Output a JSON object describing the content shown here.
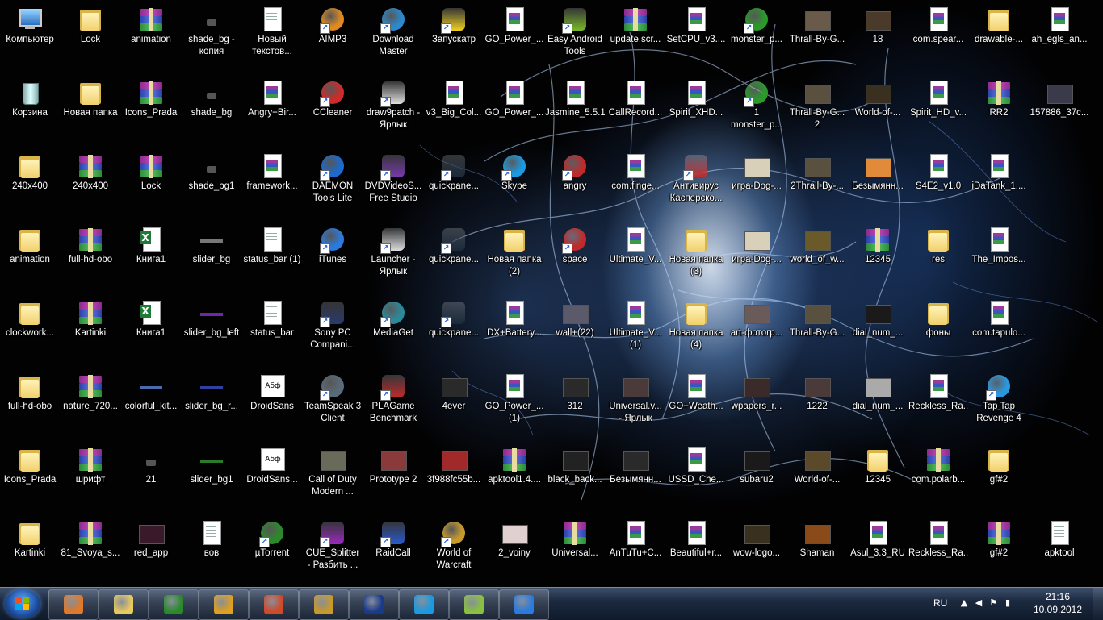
{
  "desktop": {
    "columns": [
      [
        {
          "label": "Компьютер",
          "type": "pc"
        },
        {
          "label": "Корзина",
          "type": "bin"
        },
        {
          "label": "240x400",
          "type": "folder"
        },
        {
          "label": "animation",
          "type": "folder"
        },
        {
          "label": "clockwork...",
          "type": "folder"
        },
        {
          "label": "full-hd-obo",
          "type": "folder"
        },
        {
          "label": "Icons_Prada",
          "type": "folder"
        },
        {
          "label": "Kartinki",
          "type": "folder"
        }
      ],
      [
        {
          "label": "Lock",
          "type": "folder"
        },
        {
          "label": "Новая папка",
          "type": "folder"
        },
        {
          "label": "240x400",
          "type": "rar"
        },
        {
          "label": "full-hd-obo",
          "type": "rar"
        },
        {
          "label": "Kartinki",
          "type": "rar"
        },
        {
          "label": "nature_720...",
          "type": "rar"
        },
        {
          "label": "шрифт",
          "type": "rar"
        },
        {
          "label": "81_Svoya_s...",
          "type": "rar"
        }
      ],
      [
        {
          "label": "animation",
          "type": "rar"
        },
        {
          "label": "Icons_Prada",
          "type": "rar"
        },
        {
          "label": "Lock",
          "type": "rar"
        },
        {
          "label": "Книга1",
          "type": "excel"
        },
        {
          "label": "Книга1",
          "type": "excel"
        },
        {
          "label": "colorful_kit...",
          "type": "strip",
          "color": "#4a6ab0"
        },
        {
          "label": "21",
          "type": "small"
        },
        {
          "label": "red_app",
          "type": "thumb",
          "color": "#3a1a2a"
        }
      ],
      [
        {
          "label": "shade_bg -\nкопия",
          "type": "small"
        },
        {
          "label": "shade_bg",
          "type": "small"
        },
        {
          "label": "shade_bg1",
          "type": "small"
        },
        {
          "label": "slider_bg",
          "type": "strip",
          "color": "#777777"
        },
        {
          "label": "slider_bg_left",
          "type": "strip",
          "color": "#6a2aa8"
        },
        {
          "label": "slider_bg_r...",
          "type": "strip",
          "color": "#3040a0"
        },
        {
          "label": "slider_bg1",
          "type": "strip",
          "color": "#2a7a2a"
        },
        {
          "label": "вов",
          "type": "doc"
        }
      ],
      [
        {
          "label": "Новый\nтекстов...",
          "type": "doc"
        },
        {
          "label": "Angry+Bir...",
          "type": "rarfile"
        },
        {
          "label": "framework...",
          "type": "rarfile"
        },
        {
          "label": "status_bar (1)",
          "type": "doc"
        },
        {
          "label": "status_bar",
          "type": "doc"
        },
        {
          "label": "DroidSans",
          "type": "font",
          "font_sample": "Абф"
        },
        {
          "label": "DroidSans...",
          "type": "font",
          "font_sample": "Абф"
        },
        {
          "label": "µTorrent",
          "type": "round",
          "color": "#2a8a2a"
        }
      ],
      [
        {
          "label": "AIMP3",
          "type": "round",
          "color": "#e08a20"
        },
        {
          "label": "CCleaner",
          "type": "round",
          "color": "#d02a2a"
        },
        {
          "label": "DAEMON\nTools Lite",
          "type": "round",
          "color": "#1a6ad0"
        },
        {
          "label": "iTunes",
          "type": "round",
          "color": "#2a7ae0"
        },
        {
          "label": "Sony PC\nCompani...",
          "type": "app",
          "color": "#2a3a6a"
        },
        {
          "label": "TeamSpeak 3\nClient",
          "type": "round",
          "color": "#5a6a7a"
        },
        {
          "label": "Call of Duty\nModern ...",
          "type": "thumb",
          "color": "#6a6a5a"
        },
        {
          "label": "CUE_Splitter\n- Разбить ...",
          "type": "app",
          "color": "#9a2ac0"
        }
      ],
      [
        {
          "label": "Download\nMaster",
          "type": "round",
          "color": "#2a8ad0"
        },
        {
          "label": "draw9patch -\nЯрлык",
          "type": "app",
          "color": "#e0e0e0"
        },
        {
          "label": "DVDVideoS...\nFree Studio",
          "type": "app",
          "color": "#7a3ab0"
        },
        {
          "label": "Launcher -\nЯрлык",
          "type": "app",
          "color": "#dddddd"
        },
        {
          "label": "MediaGet",
          "type": "round",
          "color": "#2a8a9a"
        },
        {
          "label": "PLAGame\nBenchmark",
          "type": "app",
          "color": "#c02a2a"
        },
        {
          "label": "Prototype 2",
          "type": "thumb",
          "color": "#8a3a3a"
        },
        {
          "label": "RaidCall",
          "type": "app",
          "color": "#2a5ad0"
        }
      ],
      [
        {
          "label": "Запускатр",
          "type": "app",
          "color": "#f0d020"
        },
        {
          "label": "v3_Big_Col...",
          "type": "rarfile"
        },
        {
          "label": "quickpane...",
          "type": "app",
          "color": "#1a2a3a"
        },
        {
          "label": "quickpane...",
          "type": "app",
          "color": "#1a2a3a"
        },
        {
          "label": "quickpane...",
          "type": "app",
          "color": "#1a2a3a"
        },
        {
          "label": "4ever",
          "type": "thumb",
          "color": "#2a2a2a"
        },
        {
          "label": "3f988fc55b...",
          "type": "thumb",
          "color": "#a02a2a"
        },
        {
          "label": "World of\nWarcraft",
          "type": "round",
          "color": "#c89a2a"
        }
      ],
      [
        {
          "label": "GO_Power_...",
          "type": "rarfile"
        },
        {
          "label": "GO_Power_...",
          "type": "rarfile"
        },
        {
          "label": "Skype",
          "type": "round",
          "color": "#1a9ae0"
        },
        {
          "label": "Новая папка\n(2)",
          "type": "folder"
        },
        {
          "label": "DX+Battery...",
          "type": "rarfile"
        },
        {
          "label": "GO_Power_...\n(1)",
          "type": "rarfile"
        },
        {
          "label": "apktool1.4....",
          "type": "rar"
        },
        {
          "label": "2_voiny",
          "type": "thumb",
          "color": "#e0d0d0"
        }
      ],
      [
        {
          "label": "Easy Android\nTools",
          "type": "app",
          "color": "#7ab82a"
        },
        {
          "label": "Jasmine_5.5.1",
          "type": "rarfile"
        },
        {
          "label": "angry",
          "type": "round",
          "color": "#c02a2a"
        },
        {
          "label": "space",
          "type": "round",
          "color": "#c02a2a"
        },
        {
          "label": "wall+(22)",
          "type": "thumb",
          "color": "#5a5a6a"
        },
        {
          "label": "312",
          "type": "thumb",
          "color": "#2a2a2a"
        },
        {
          "label": "black_back...",
          "type": "thumb",
          "color": "#222222"
        },
        {
          "label": "Universal...",
          "type": "rar"
        }
      ],
      [
        {
          "label": "update.scr...",
          "type": "rar"
        },
        {
          "label": "CallRecord...",
          "type": "rarfile"
        },
        {
          "label": "com.finge...",
          "type": "rarfile"
        },
        {
          "label": "Ultimate_V...",
          "type": "rarfile"
        },
        {
          "label": "Ultimate_V...\n(1)",
          "type": "rarfile"
        },
        {
          "label": "Universal.v...\n- Ярлык",
          "type": "thumb",
          "color": "#4a3a3a"
        },
        {
          "label": "Безымянн...",
          "type": "thumb",
          "color": "#2a2a2a"
        },
        {
          "label": "AnTuTu+C...",
          "type": "rarfile"
        }
      ],
      [
        {
          "label": "SetCPU_v3....",
          "type": "rarfile"
        },
        {
          "label": "Spirit_XHD...",
          "type": "rarfile"
        },
        {
          "label": "Антивирус\nКасперско...",
          "type": "app",
          "color": "#c02a2a"
        },
        {
          "label": "Новая папка\n(3)",
          "type": "folder"
        },
        {
          "label": "Новая папка\n(4)",
          "type": "folder"
        },
        {
          "label": "GO+Weath...",
          "type": "rarfile"
        },
        {
          "label": "USSD_Che...",
          "type": "rarfile"
        },
        {
          "label": "Beautiful+r...",
          "type": "rarfile"
        }
      ],
      [
        {
          "label": "monster_p...",
          "type": "round",
          "color": "#2a9a2a"
        },
        {
          "label": "1\nmonster_p...",
          "type": "round",
          "color": "#2a9a2a"
        },
        {
          "label": "игра-Dog-...",
          "type": "thumb",
          "color": "#d8d0b8"
        },
        {
          "label": "игра-Dog-...",
          "type": "thumb",
          "color": "#d8d0b8"
        },
        {
          "label": "art-фотогр...",
          "type": "thumb",
          "color": "#6a5a5a"
        },
        {
          "label": "wpapers_r...",
          "type": "thumb",
          "color": "#3a2a2a"
        },
        {
          "label": "subaru2",
          "type": "thumb",
          "color": "#1a1a1a"
        },
        {
          "label": "wow-logo...",
          "type": "thumb",
          "color": "#3a3020"
        }
      ],
      [
        {
          "label": "Thrall-By-G...",
          "type": "thumb",
          "color": "#6a5a4a"
        },
        {
          "label": "Thrall-By-G...\n2",
          "type": "thumb",
          "color": "#5a5040"
        },
        {
          "label": "2Thrall-By-...",
          "type": "thumb",
          "color": "#5a5040"
        },
        {
          "label": "world_of_w...",
          "type": "thumb",
          "color": "#6a5a2a"
        },
        {
          "label": "Thrall-By-G...",
          "type": "thumb",
          "color": "#5a5040"
        },
        {
          "label": "1222",
          "type": "thumb",
          "color": "#4a3a3a"
        },
        {
          "label": "World-of-...",
          "type": "thumb",
          "color": "#5a4a2a"
        },
        {
          "label": "Shaman",
          "type": "thumb",
          "color": "#8a4a1a"
        }
      ],
      [
        {
          "label": "18",
          "type": "thumb",
          "color": "#4a3a2a"
        },
        {
          "label": "World-of-...",
          "type": "thumb",
          "color": "#3a3020"
        },
        {
          "label": "Безымянн...",
          "type": "thumb",
          "color": "#e08a3a"
        },
        {
          "label": "12345",
          "type": "rar"
        },
        {
          "label": "dial_num_...",
          "type": "thumb",
          "color": "#1a1a1a"
        },
        {
          "label": "dial_num_...",
          "type": "thumb",
          "color": "#aaaaaa"
        },
        {
          "label": "12345",
          "type": "folder"
        },
        {
          "label": "Asul_3.3_RU",
          "type": "rarfile"
        }
      ],
      [
        {
          "label": "com.spear...",
          "type": "rarfile"
        },
        {
          "label": "Spirit_HD_v...",
          "type": "rarfile"
        },
        {
          "label": "S4E2_v1.0",
          "type": "rarfile"
        },
        {
          "label": "res",
          "type": "folder"
        },
        {
          "label": "фоны",
          "type": "folder"
        },
        {
          "label": "Reckless_Ra...",
          "type": "rarfile"
        },
        {
          "label": "com.polarb...",
          "type": "rar"
        },
        {
          "label": "Reckless_Ra...",
          "type": "rarfile"
        }
      ],
      [
        {
          "label": "drawable-...",
          "type": "folder"
        },
        {
          "label": "RR2",
          "type": "rar"
        },
        {
          "label": "iDaTank_1....",
          "type": "rarfile"
        },
        {
          "label": "The_Impos...",
          "type": "rarfile"
        },
        {
          "label": "com.tapulo...",
          "type": "rarfile"
        },
        {
          "label": "Tap Tap\nRevenge 4",
          "type": "round",
          "color": "#2a9ae0"
        },
        {
          "label": "gf#2",
          "type": "folder"
        },
        {
          "label": "gf#2",
          "type": "rar"
        }
      ],
      [
        {
          "label": "ah_egls_an...",
          "type": "rarfile"
        },
        {
          "label": "157886_37c...",
          "type": "thumb",
          "color": "#3a3a4a"
        },
        null,
        null,
        null,
        null,
        null,
        {
          "label": "apktool",
          "type": "doc"
        }
      ]
    ]
  },
  "taskbar": {
    "start_label": "Start",
    "pinned": [
      {
        "name": "media-player",
        "color": "#e07a2a"
      },
      {
        "name": "explorer",
        "color": "#e8c860"
      },
      {
        "name": "utorrent",
        "color": "#2a8a2a"
      },
      {
        "name": "aimp",
        "color": "#e0a020"
      },
      {
        "name": "chrome",
        "color": "#d04a2a"
      },
      {
        "name": "world-of-warcraft",
        "color": "#c89a2a"
      },
      {
        "name": "photoshop",
        "color": "#1a3a8a"
      },
      {
        "name": "skype",
        "color": "#1a9ae0"
      },
      {
        "name": "network-app",
        "color": "#8ac040"
      },
      {
        "name": "itunes",
        "color": "#2a7ae0"
      }
    ],
    "tray": {
      "language": "RU",
      "time": "21:16",
      "date": "10.09.2012"
    }
  }
}
